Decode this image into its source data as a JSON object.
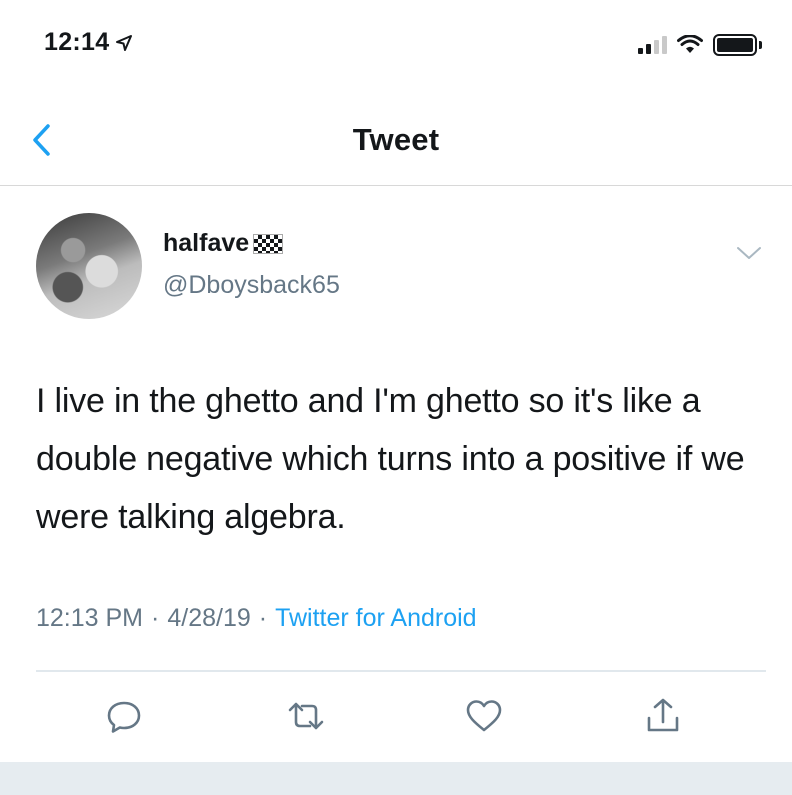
{
  "status_bar": {
    "time": "12:14"
  },
  "nav": {
    "title": "Tweet"
  },
  "tweet": {
    "display_name": "halfave",
    "handle": "@Dboysback65",
    "text": "I live in the ghetto and I'm ghetto so it's like a double negative which turns into a positive if we were talking algebra.",
    "time": "12:13 PM",
    "separator": "·",
    "date": "4/28/19",
    "source": "Twitter for Android"
  },
  "actions": {
    "reply_icon": "reply-icon",
    "retweet_icon": "retweet-icon",
    "like_icon": "heart-icon",
    "share_icon": "share-icon"
  },
  "colors": {
    "accent": "#1da1f2",
    "secondary_text": "#657786",
    "primary_text": "#14171a",
    "divider": "#e1e8ed"
  }
}
